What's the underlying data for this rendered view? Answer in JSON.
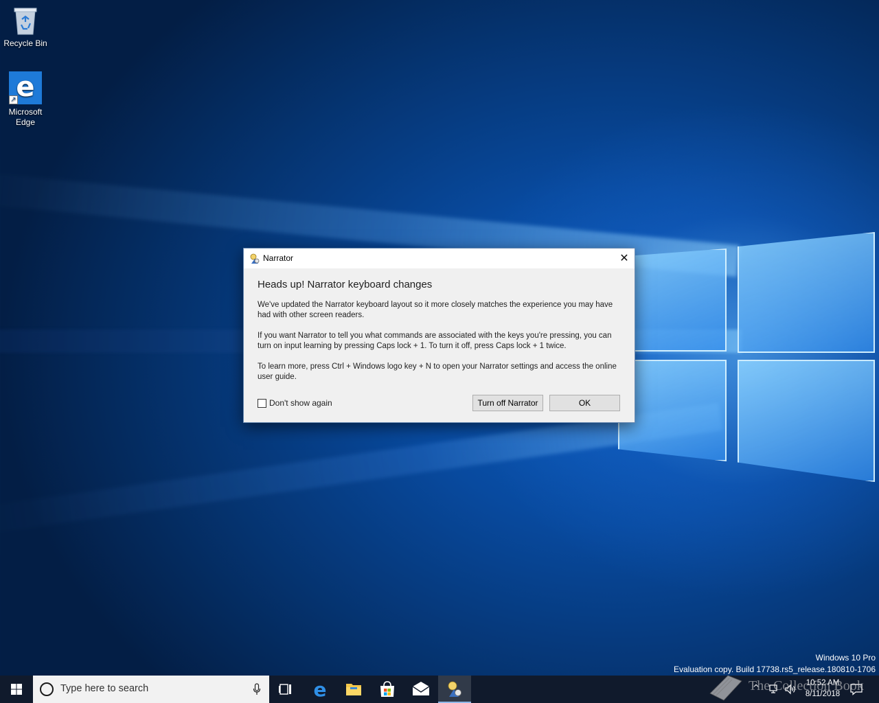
{
  "desktop": {
    "icons": [
      {
        "label": "Recycle Bin"
      },
      {
        "label": "Microsoft\nEdge"
      }
    ]
  },
  "dialog": {
    "title": "Narrator",
    "close_glyph": "✕",
    "heading": "Heads up! Narrator keyboard changes",
    "paragraphs": [
      "We've updated the Narrator keyboard layout so it more closely matches the experience you may have had with other screen readers.",
      "If you want Narrator to tell you what commands are associated with the keys you're pressing, you can turn on input learning by pressing Caps lock + 1. To turn it off, press Caps lock + 1 twice.",
      "To learn more, press Ctrl + Windows logo key + N to open your Narrator settings and access the online user guide."
    ],
    "checkbox_label": "Don't show again",
    "checkbox_checked": false,
    "turn_off_label": "Turn off Narrator",
    "ok_label": "OK"
  },
  "watermark": {
    "line1": "Windows 10 Pro",
    "line2": "Evaluation copy. Build 17738.rs5_release.180810-1706"
  },
  "logo_overlay": {
    "text": "The Collection Book"
  },
  "taskbar": {
    "search_placeholder": "Type here to search",
    "pinned": [
      "task-view",
      "edge",
      "file-explorer",
      "store",
      "mail",
      "narrator"
    ],
    "tray": {
      "up_glyph": "^",
      "time": "10:52 AM",
      "date": "8/11/2018"
    }
  },
  "colors": {
    "taskbar_bg": "#101a2c",
    "dialog_bg": "#f0f0f0",
    "accent": "#1e7ad8"
  }
}
